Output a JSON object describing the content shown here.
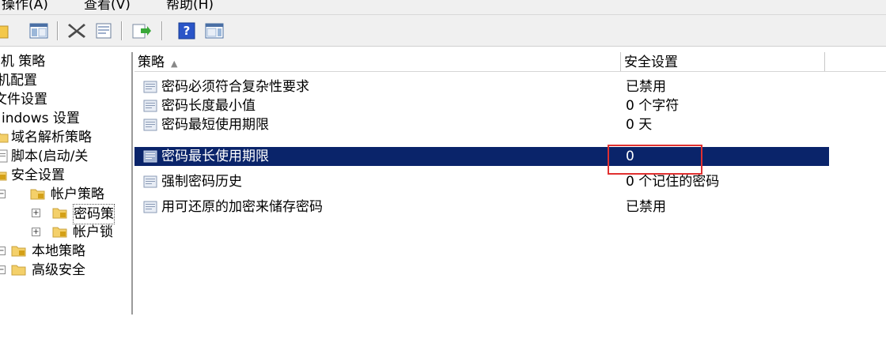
{
  "menubar": {
    "items": [
      "操作(A)",
      "查看(V)",
      "帮助(H)"
    ]
  },
  "toolbar": {
    "icons": [
      "up-folder-icon",
      "show-hide-tree-icon",
      "delete-icon",
      "properties-icon",
      "export-list-icon",
      "help-icon",
      "show-action-pane-icon"
    ]
  },
  "tree": {
    "items": [
      {
        "label": "计算机 策略",
        "visible_text": "!机 策略"
      },
      {
        "label": "机配置"
      },
      {
        "label": "文件设置"
      },
      {
        "label": "indows 设置"
      },
      {
        "label": "域名解析策略"
      },
      {
        "label": "脚本(启动/关"
      },
      {
        "label": "安全设置"
      },
      {
        "label": "帐户策略"
      },
      {
        "label": "密码策"
      },
      {
        "label": "帐户锁"
      },
      {
        "label": "本地策略"
      },
      {
        "label": "高级安全"
      }
    ]
  },
  "list": {
    "columns": {
      "policy": "策略",
      "setting": "安全设置"
    },
    "rows": [
      {
        "policy": "密码必须符合复杂性要求",
        "setting": "已禁用"
      },
      {
        "policy": "密码长度最小值",
        "setting": "0 个字符"
      },
      {
        "policy": "密码最短使用期限",
        "setting": "0 天"
      },
      {
        "policy": "密码最长使用期限",
        "setting": "0",
        "selected": true
      },
      {
        "policy": "强制密码历史",
        "setting": "0 个记住的密码"
      },
      {
        "policy": "用可还原的加密来储存密码",
        "setting": "已禁用"
      }
    ]
  },
  "colors": {
    "selection": "#0a246a",
    "highlight_box": "#e03030",
    "chrome": "#f0f0f0"
  }
}
